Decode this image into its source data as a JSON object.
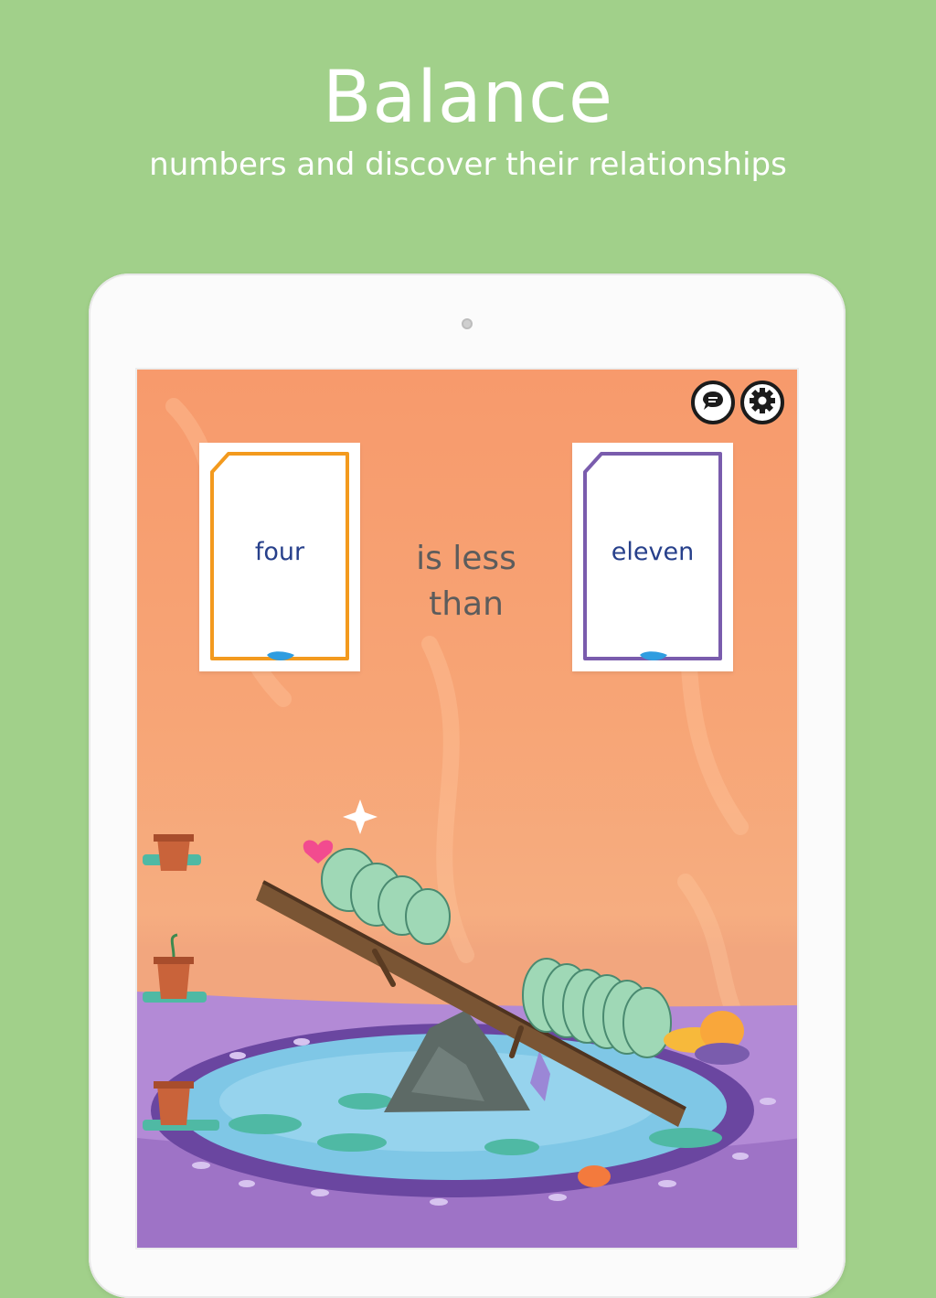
{
  "promo": {
    "headline": "Balance",
    "subline": "numbers and discover their relationships"
  },
  "game": {
    "toolbar": {
      "chat_icon": "speech-bubble-icon",
      "settings_icon": "gear-icon"
    },
    "left_card": {
      "word": "four",
      "border_color": "#f39a1e"
    },
    "right_card": {
      "word": "eleven",
      "border_color": "#7a5cad"
    },
    "relation": {
      "line1": "is less",
      "line2": "than"
    }
  },
  "colors": {
    "page_background": "#a1d08a",
    "screen_background": "#f7a576",
    "pond_floor": "#b38ad6",
    "water": "#7fc7e6",
    "number_word_text": "#27408b"
  }
}
